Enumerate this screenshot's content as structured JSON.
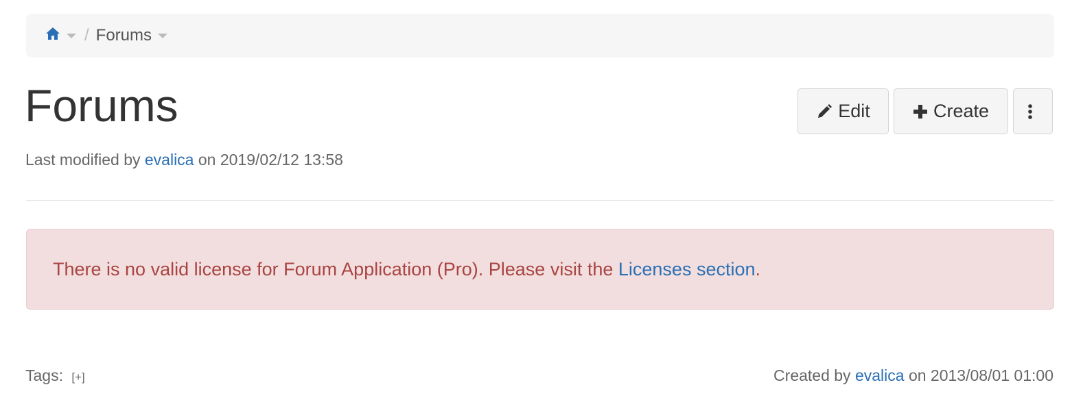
{
  "breadcrumb": {
    "home_icon": "home-icon",
    "separator": "/",
    "current": "Forums"
  },
  "page": {
    "title": "Forums",
    "modified_prefix": "Last modified by",
    "modified_user": "evalica",
    "modified_on": "on 2019/02/12 13:58"
  },
  "actions": {
    "edit_label": "Edit",
    "create_label": "Create",
    "more_icon": "more-vertical-icon"
  },
  "alert": {
    "message": "There is no valid license for Forum Application (Pro). Please visit the",
    "link_text": "Licenses section",
    "suffix": "."
  },
  "footer": {
    "tags_label": "Tags:",
    "tags_add": "[+]",
    "created_prefix": "Created by",
    "created_user": "evalica",
    "created_on": "on 2013/08/01 01:00"
  },
  "colors": {
    "link": "#2a6fb5",
    "alert_bg": "#f2dede",
    "alert_text": "#a94442",
    "breadcrumb_bg": "#f6f6f6"
  }
}
